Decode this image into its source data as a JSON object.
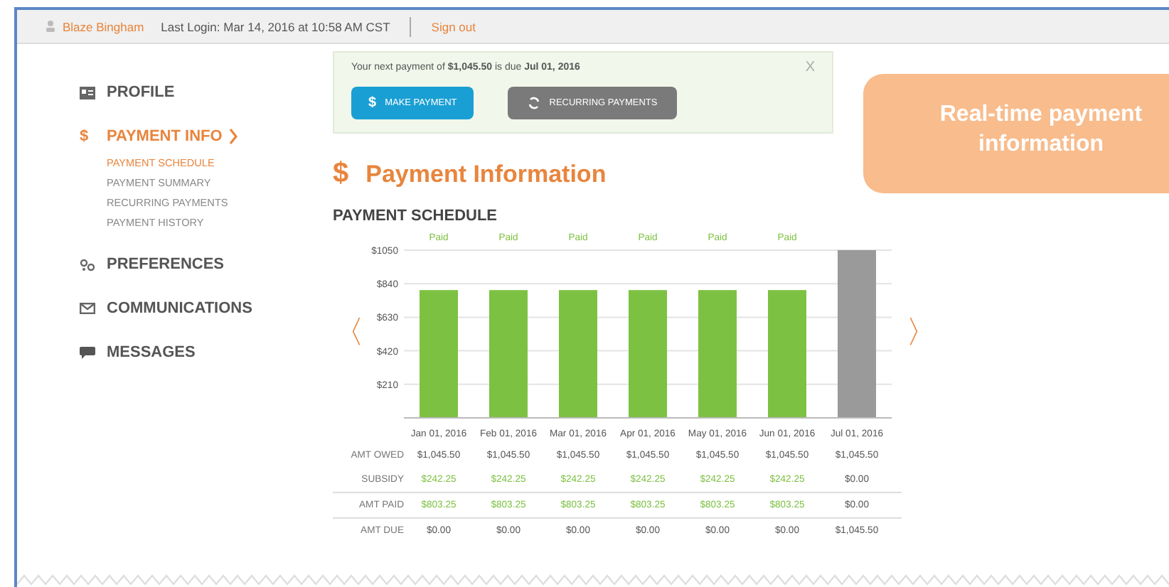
{
  "top_bar": {
    "user": "Blaze Bingham",
    "last_login": "Last Login: Mar 14, 2016 at 10:58 AM CST",
    "sign_out": "Sign out"
  },
  "sidebar": {
    "items": [
      {
        "label": "PROFILE",
        "selected": false,
        "expanded": false
      },
      {
        "label": "PAYMENT INFO",
        "selected": true,
        "expanded": true,
        "children": [
          {
            "label": "PAYMENT SCHEDULE",
            "selected": true
          },
          {
            "label": "PAYMENT SUMMARY",
            "selected": false
          },
          {
            "label": "RECURRING PAYMENTS",
            "selected": false
          },
          {
            "label": "PAYMENT HISTORY",
            "selected": false
          }
        ]
      },
      {
        "label": "PREFERENCES",
        "selected": false,
        "expanded": false
      },
      {
        "label": "COMMUNICATIONS",
        "selected": false,
        "expanded": false
      },
      {
        "label": "MESSAGES",
        "selected": false,
        "expanded": false
      }
    ]
  },
  "notice": {
    "text": "Your next payment of **$1,045.50** is due **Jul 01, 2016**",
    "close": "X",
    "buttons": [
      {
        "label": "MAKE PAYMENT",
        "kind": "primary",
        "icon": "$"
      },
      {
        "label": "RECURRING PAYMENTS",
        "kind": "secondary"
      }
    ]
  },
  "callout": {
    "text": "Real-time payment information"
  },
  "heading": {
    "icon": "$",
    "title": "Payment Information"
  },
  "subheading": "PAYMENT SCHEDULE",
  "chart_prev": "〈",
  "chart_next": "〉",
  "chart_data": {
    "type": "bar",
    "grid": true,
    "categories": [
      "Jan 01, 2016",
      "Feb 01, 2016",
      "Mar 01, 2016",
      "Apr 01, 2016",
      "May 01, 2016",
      "Jun 01, 2016",
      "Jul 01, 2016"
    ],
    "series": [
      {
        "color": "#7dc142",
        "values": [
          800,
          800,
          800,
          800,
          800,
          800,
          null
        ]
      },
      {
        "color": "#9a9a9a",
        "values": [
          null,
          null,
          null,
          null,
          null,
          null,
          1050
        ]
      }
    ],
    "ylim": [
      0,
      1050
    ],
    "yticks": [
      {
        "value": 210,
        "label": "$210"
      },
      {
        "value": 420,
        "label": "$420"
      },
      {
        "value": 630,
        "label": "$630"
      },
      {
        "value": 840,
        "label": "$840"
      },
      {
        "value": 1050,
        "label": "$1050"
      }
    ],
    "annotations": [
      "Paid",
      "Paid",
      "Paid",
      "Paid",
      "Paid",
      "Paid"
    ]
  },
  "table": {
    "rows": [
      {
        "label": "AMT OWED",
        "divider": false,
        "cells": [
          {
            "text": "$1,045.50",
            "highlight": false
          },
          {
            "text": "$1,045.50",
            "highlight": false
          },
          {
            "text": "$1,045.50",
            "highlight": false
          },
          {
            "text": "$1,045.50",
            "highlight": false
          },
          {
            "text": "$1,045.50",
            "highlight": false
          },
          {
            "text": "$1,045.50",
            "highlight": false
          },
          {
            "text": "$1,045.50",
            "highlight": false
          }
        ]
      },
      {
        "label": "SUBSIDY",
        "divider": true,
        "cells": [
          {
            "text": "$242.25",
            "highlight": true
          },
          {
            "text": "$242.25",
            "highlight": true
          },
          {
            "text": "$242.25",
            "highlight": true
          },
          {
            "text": "$242.25",
            "highlight": true
          },
          {
            "text": "$242.25",
            "highlight": true
          },
          {
            "text": "$242.25",
            "highlight": true
          },
          {
            "text": "$0.00",
            "highlight": false
          }
        ]
      },
      {
        "label": "AMT PAID",
        "divider": true,
        "cells": [
          {
            "text": "$803.25",
            "highlight": true
          },
          {
            "text": "$803.25",
            "highlight": true
          },
          {
            "text": "$803.25",
            "highlight": true
          },
          {
            "text": "$803.25",
            "highlight": true
          },
          {
            "text": "$803.25",
            "highlight": true
          },
          {
            "text": "$803.25",
            "highlight": true
          },
          {
            "text": "$0.00",
            "highlight": false
          }
        ]
      },
      {
        "label": "AMT DUE",
        "divider": false,
        "cells": [
          {
            "text": "$0.00",
            "highlight": false
          },
          {
            "text": "$0.00",
            "highlight": false
          },
          {
            "text": "$0.00",
            "highlight": false
          },
          {
            "text": "$0.00",
            "highlight": false
          },
          {
            "text": "$0.00",
            "highlight": false
          },
          {
            "text": "$0.00",
            "highlight": false
          },
          {
            "text": "$1,045.50",
            "highlight": false
          }
        ]
      }
    ]
  }
}
